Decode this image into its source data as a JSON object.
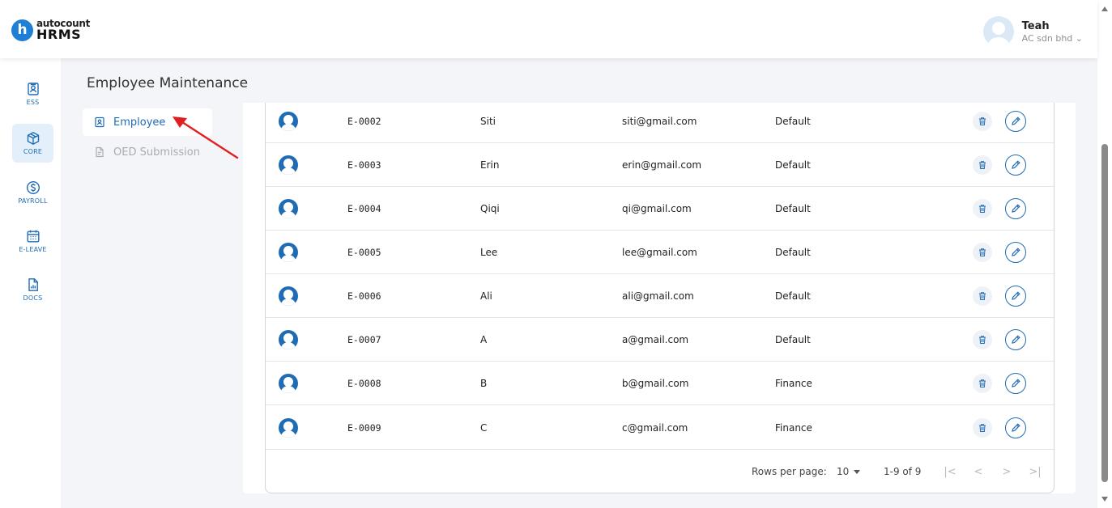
{
  "brand": {
    "top": "autocount",
    "bottom": "HRMS",
    "letter": "h",
    "color": "#1f7fd6"
  },
  "user": {
    "name": "Teah",
    "company": "AC sdn bhd"
  },
  "sidebar": {
    "items": [
      {
        "label": "ESS",
        "icon": "id-card-icon"
      },
      {
        "label": "CORE",
        "icon": "cube-icon"
      },
      {
        "label": "PAYROLL",
        "icon": "dollar-circle-icon"
      },
      {
        "label": "E-LEAVE",
        "icon": "calendar-icon"
      },
      {
        "label": "DOCS",
        "icon": "document-chart-icon"
      }
    ]
  },
  "page": {
    "title": "Employee Maintenance"
  },
  "submenu": {
    "items": [
      {
        "label": "Employee",
        "icon": "badge-icon"
      },
      {
        "label": "OED Submission",
        "icon": "document-icon"
      }
    ]
  },
  "table": {
    "rows": [
      {
        "code": "E-0002",
        "name": "Siti",
        "email": "siti@gmail.com",
        "dept": "Default"
      },
      {
        "code": "E-0003",
        "name": "Erin",
        "email": "erin@gmail.com",
        "dept": "Default"
      },
      {
        "code": "E-0004",
        "name": "Qiqi",
        "email": "qi@gmail.com",
        "dept": "Default"
      },
      {
        "code": "E-0005",
        "name": "Lee",
        "email": "lee@gmail.com",
        "dept": "Default"
      },
      {
        "code": "E-0006",
        "name": "Ali",
        "email": "ali@gmail.com",
        "dept": "Default"
      },
      {
        "code": "E-0007",
        "name": "A",
        "email": "a@gmail.com",
        "dept": "Default"
      },
      {
        "code": "E-0008",
        "name": "B",
        "email": "b@gmail.com",
        "dept": "Finance"
      },
      {
        "code": "E-0009",
        "name": "C",
        "email": "c@gmail.com",
        "dept": "Finance"
      }
    ]
  },
  "pagination": {
    "rows_label": "Rows per page:",
    "rows_value": "10",
    "range": "1-9 of 9",
    "first": "|<",
    "prev": "<",
    "next": ">",
    "last": ">|"
  },
  "colors": {
    "accent": "#1f6cb5",
    "annotation": "#e02020"
  }
}
